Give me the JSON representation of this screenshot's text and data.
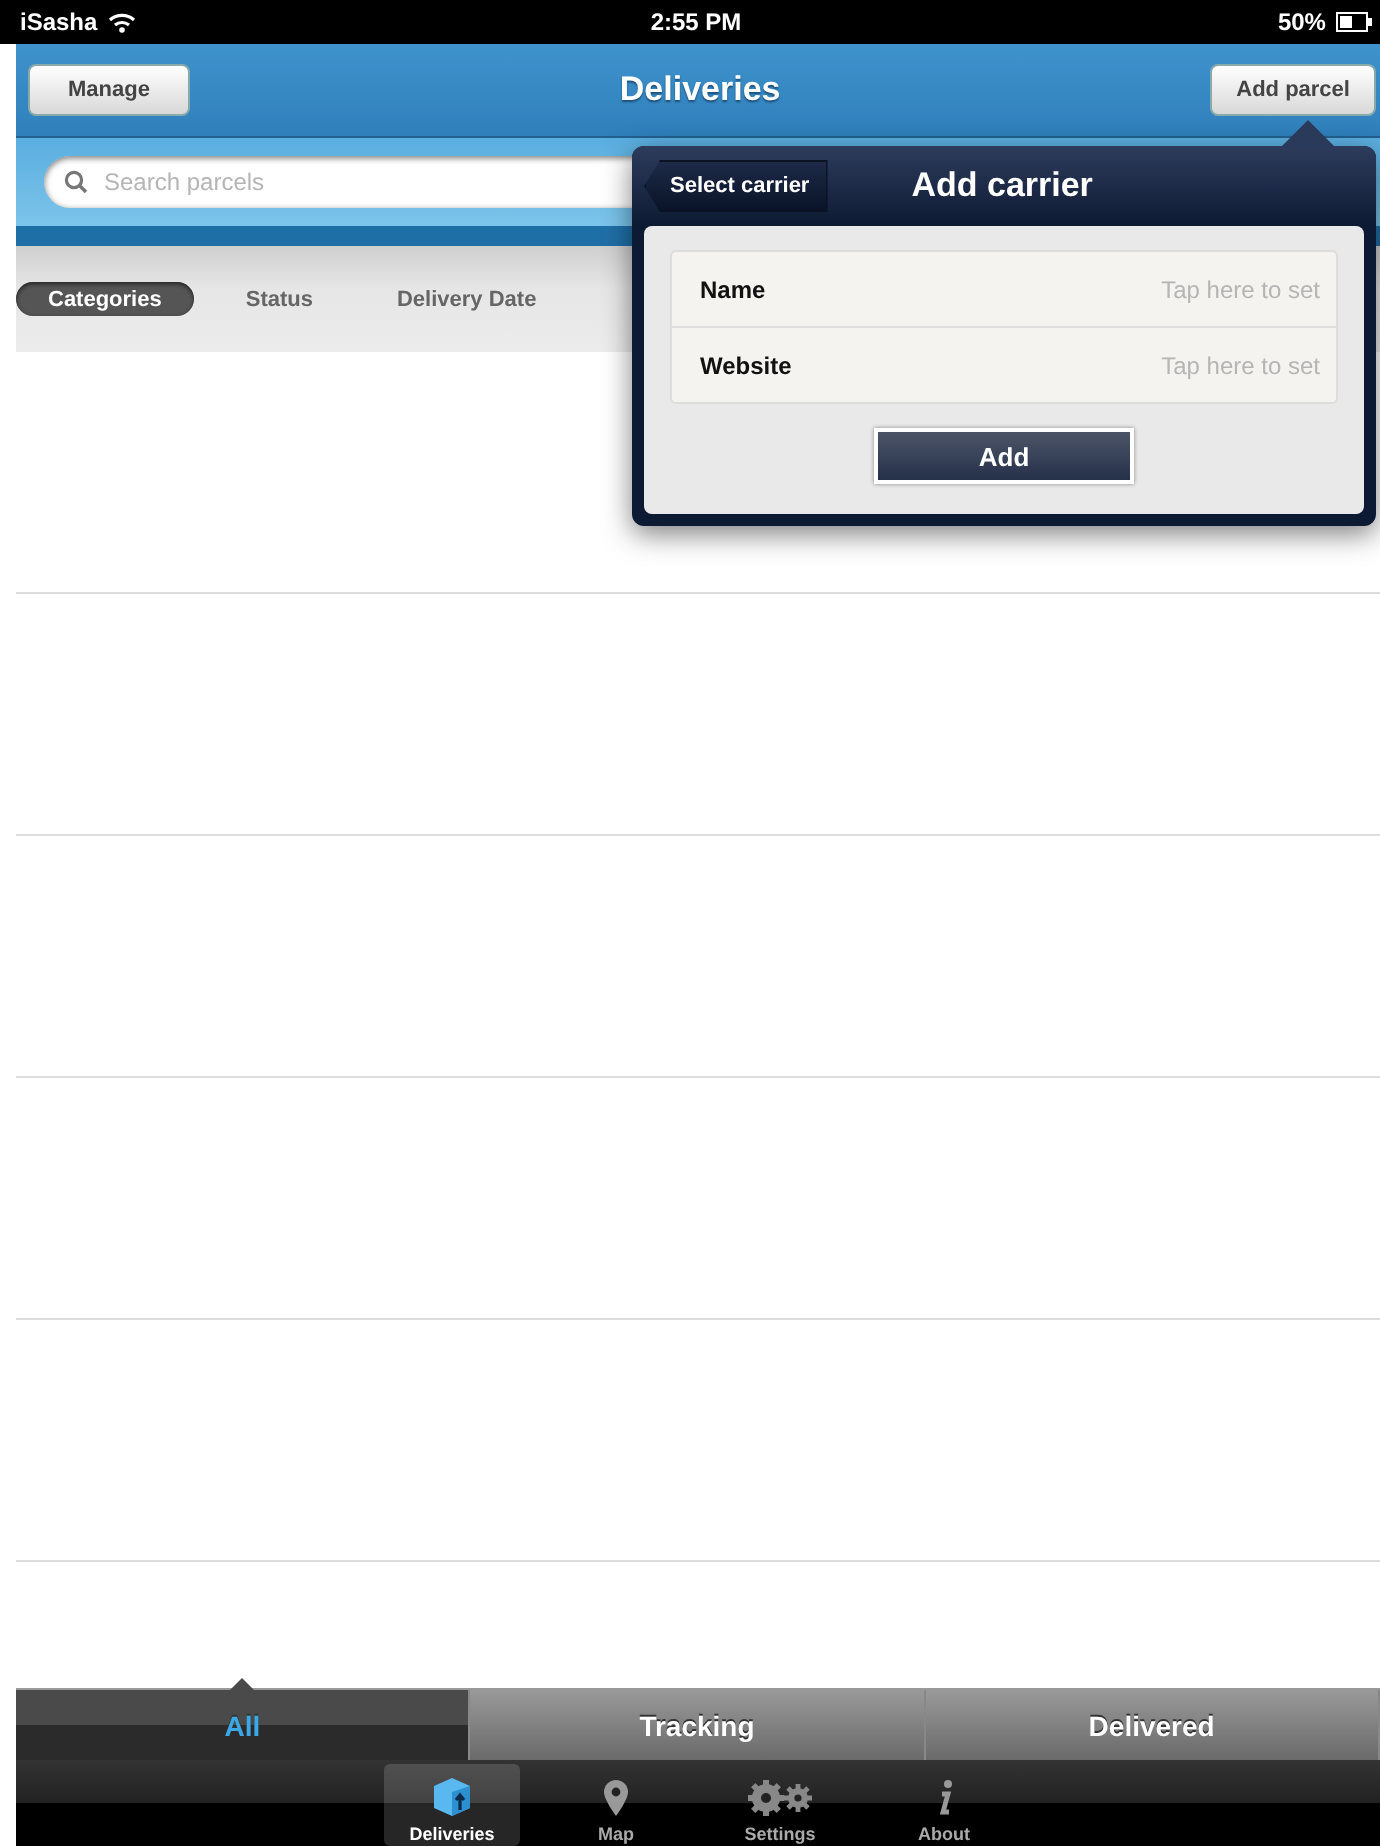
{
  "status_bar": {
    "carrier": "iSasha",
    "time": "2:55 PM",
    "battery": "50%"
  },
  "nav_bar": {
    "left_button": "Manage",
    "title": "Deliveries",
    "right_button": "Add parcel"
  },
  "search": {
    "placeholder": "Search parcels"
  },
  "filters": [
    {
      "label": "Categories",
      "selected": true
    },
    {
      "label": "Status",
      "selected": false
    },
    {
      "label": "Delivery Date",
      "selected": false
    }
  ],
  "segments": [
    {
      "label": "All",
      "selected": true
    },
    {
      "label": "Tracking",
      "selected": false
    },
    {
      "label": "Delivered",
      "selected": false
    }
  ],
  "tab_bar": [
    {
      "label": "Deliveries",
      "selected": true
    },
    {
      "label": "Map",
      "selected": false
    },
    {
      "label": "Settings",
      "selected": false
    },
    {
      "label": "About",
      "selected": false
    }
  ],
  "popover": {
    "back_button": "Select carrier",
    "title": "Add carrier",
    "fields": [
      {
        "label": "Name",
        "placeholder": "Tap here to set"
      },
      {
        "label": "Website",
        "placeholder": "Tap here to set"
      }
    ],
    "button": "Add"
  }
}
